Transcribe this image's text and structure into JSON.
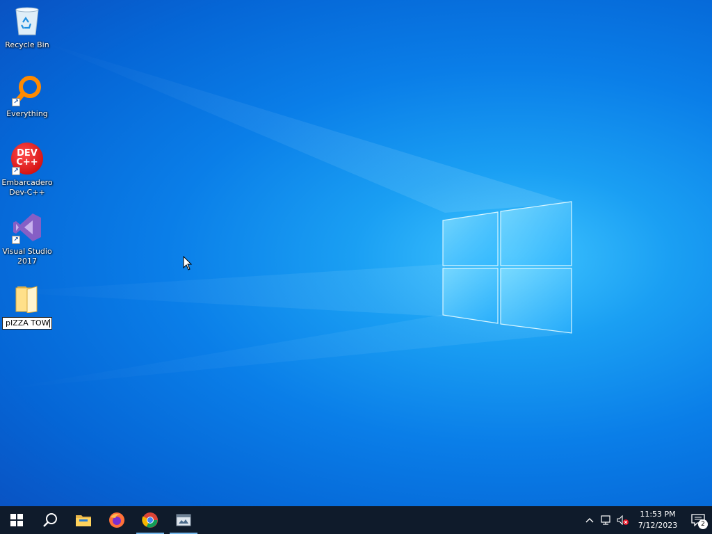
{
  "desktop": {
    "icons": [
      {
        "name": "recycle-bin",
        "label": "Recycle Bin",
        "icon": "recycle-bin-icon",
        "shortcut": false
      },
      {
        "name": "everything",
        "label": "Everything",
        "icon": "magnifier-icon",
        "shortcut": true
      },
      {
        "name": "devcpp",
        "label": "Embarcadero Dev-C++",
        "icon": "devcpp-icon",
        "shortcut": true,
        "badge_text": "DEV C++"
      },
      {
        "name": "visual-studio",
        "label": "Visual Studio 2017",
        "icon": "visual-studio-icon",
        "shortcut": true
      },
      {
        "name": "new-folder",
        "label": "",
        "icon": "folder-icon",
        "shortcut": false,
        "rename_value": "pIZZA TOW"
      }
    ]
  },
  "taskbar": {
    "pinned": [
      {
        "name": "start",
        "icon": "windows-start-icon",
        "active": false
      },
      {
        "name": "search",
        "icon": "search-icon",
        "active": false
      },
      {
        "name": "file-explorer",
        "icon": "file-explorer-icon",
        "active": false
      },
      {
        "name": "firefox",
        "icon": "firefox-icon",
        "active": false
      },
      {
        "name": "chrome",
        "icon": "chrome-icon",
        "active": true
      },
      {
        "name": "app",
        "icon": "app-window-icon",
        "active": true
      }
    ],
    "tray": {
      "icons": [
        "chevron-up-icon",
        "network-icon",
        "volume-muted-icon"
      ],
      "time": "11:53 PM",
      "date": "7/12/2023",
      "notification_count": "2"
    }
  },
  "colors": {
    "taskbar_bg": "#0f1b2b",
    "accent": "#76b9ed",
    "desktop_blue": "#0a7ee8"
  }
}
